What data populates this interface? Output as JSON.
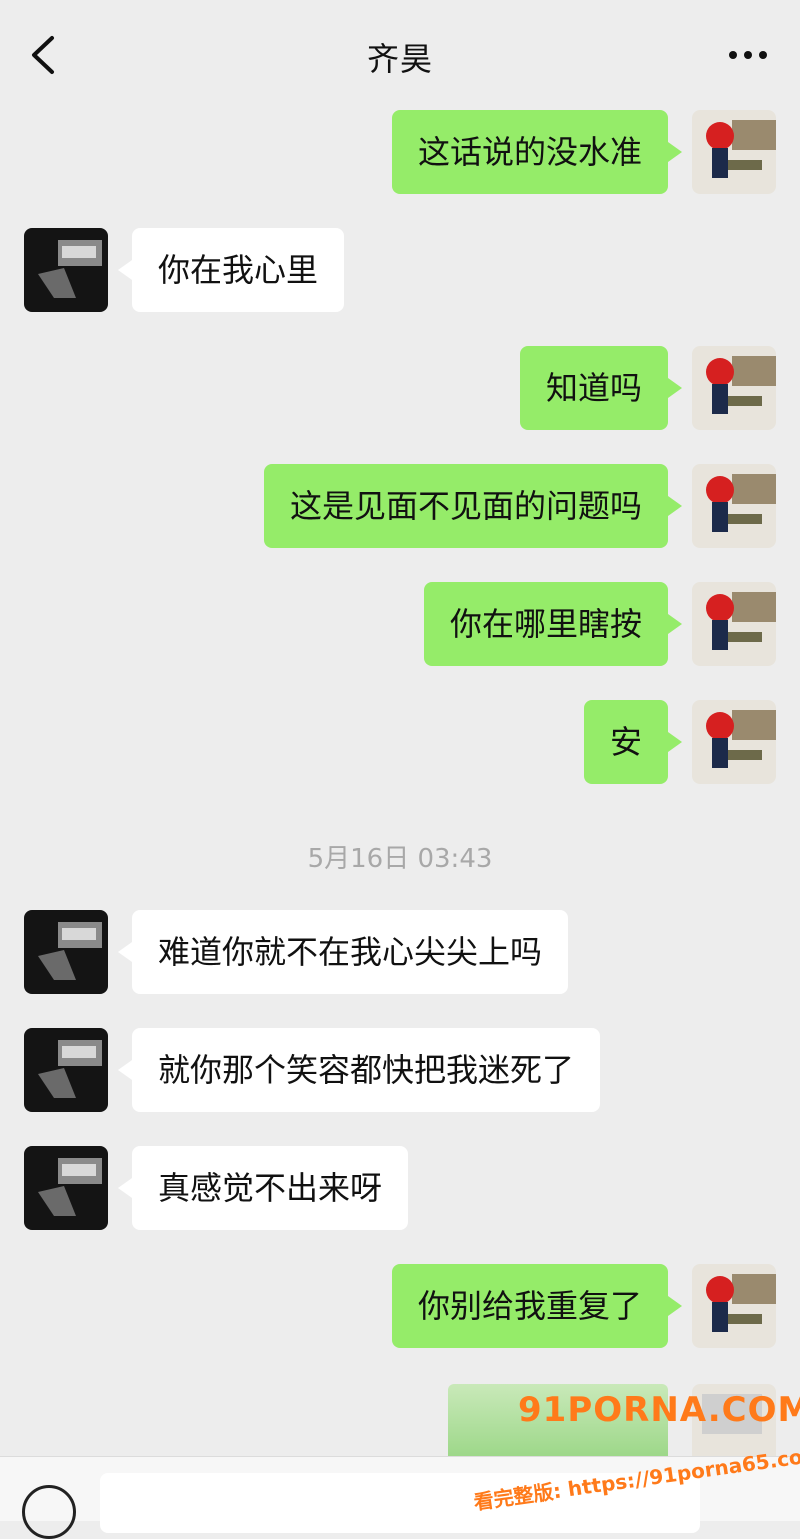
{
  "header": {
    "title": "齐昊"
  },
  "timestamp": "5月16日 03:43",
  "messages": [
    {
      "side": "right",
      "text": "这话说的没水准"
    },
    {
      "side": "left",
      "text": "你在我心里"
    },
    {
      "side": "right",
      "text": "知道吗"
    },
    {
      "side": "right",
      "text": "这是见面不见面的问题吗"
    },
    {
      "side": "right",
      "text": "你在哪里瞎按"
    },
    {
      "side": "right",
      "text": "安"
    },
    {
      "side": "left",
      "text": "难道你就不在我心尖尖上吗"
    },
    {
      "side": "left",
      "text": "就你那个笑容都快把我迷死了"
    },
    {
      "side": "left",
      "text": "真感觉不出来呀"
    },
    {
      "side": "right",
      "text": "你别给我重复了"
    }
  ],
  "watermark": {
    "logo": "91PORNA.COM",
    "url": "看完整版: https://91porna65.com"
  },
  "colors": {
    "sent_bubble": "#95ec69",
    "received_bubble": "#ffffff",
    "background": "#ededed"
  }
}
